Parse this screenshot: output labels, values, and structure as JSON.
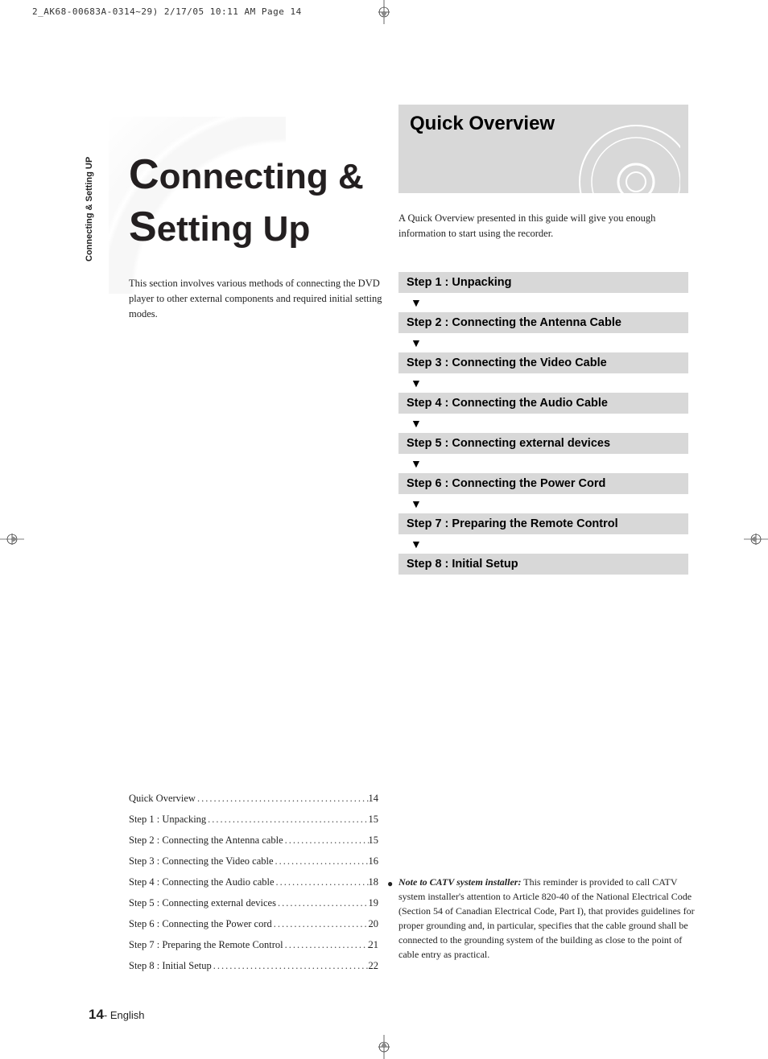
{
  "print_header": "2_AK68-00683A-0314~29)  2/17/05  10:11 AM  Page 14",
  "side_tab": "Connecting & Setting UP",
  "main_title": {
    "line1_cap": "C",
    "line1_rest": "onnecting &",
    "line2_cap": "S",
    "line2_rest": "etting Up"
  },
  "intro_text": "This section involves various methods of connecting the DVD player to other external components and required initial setting modes.",
  "quick_overview": {
    "title": "Quick Overview",
    "description": "A Quick Overview presented in this guide will give you enough information to start using the recorder."
  },
  "steps": [
    "Step 1 : Unpacking",
    "Step 2 : Connecting the Antenna Cable",
    "Step 3 : Connecting the Video Cable",
    "Step 4 : Connecting the Audio Cable",
    "Step 5 : Connecting external devices",
    "Step 6 : Connecting the Power Cord",
    "Step 7 : Preparing the Remote Control",
    "Step 8 : Initial Setup"
  ],
  "arrow_glyph": "▼",
  "toc": [
    {
      "label": "Quick Overview",
      "page": "14"
    },
    {
      "label": "Step 1 : Unpacking",
      "page": "15"
    },
    {
      "label": "Step 2 : Connecting the Antenna cable ",
      "page": "15"
    },
    {
      "label": "Step 3 : Connecting the Video cable",
      "page": "16"
    },
    {
      "label": "Step 4 : Connecting the Audio cable",
      "page": "18"
    },
    {
      "label": "Step 5 : Connecting external devices",
      "page": "19"
    },
    {
      "label": "Step 6 : Connecting the Power cord",
      "page": "20"
    },
    {
      "label": "Step 7 : Preparing the Remote Control",
      "page": "21"
    },
    {
      "label": "Step 8 : Initial Setup",
      "page": "22"
    }
  ],
  "note": {
    "bullet": "●",
    "lead": "Note to CATV system installer:",
    "body": " This reminder is provided to call CATV system installer's attention to Article 820-40 of the National Electrical Code (Section 54 of Canadian Electrical Code, Part I), that provides guidelines for proper grounding and, in particular, specifies that the cable ground shall be connected to the grounding system of the building as close to the point of cable entry as practical."
  },
  "page_footer": {
    "number": "14",
    "dash": "- ",
    "lang": "English"
  }
}
